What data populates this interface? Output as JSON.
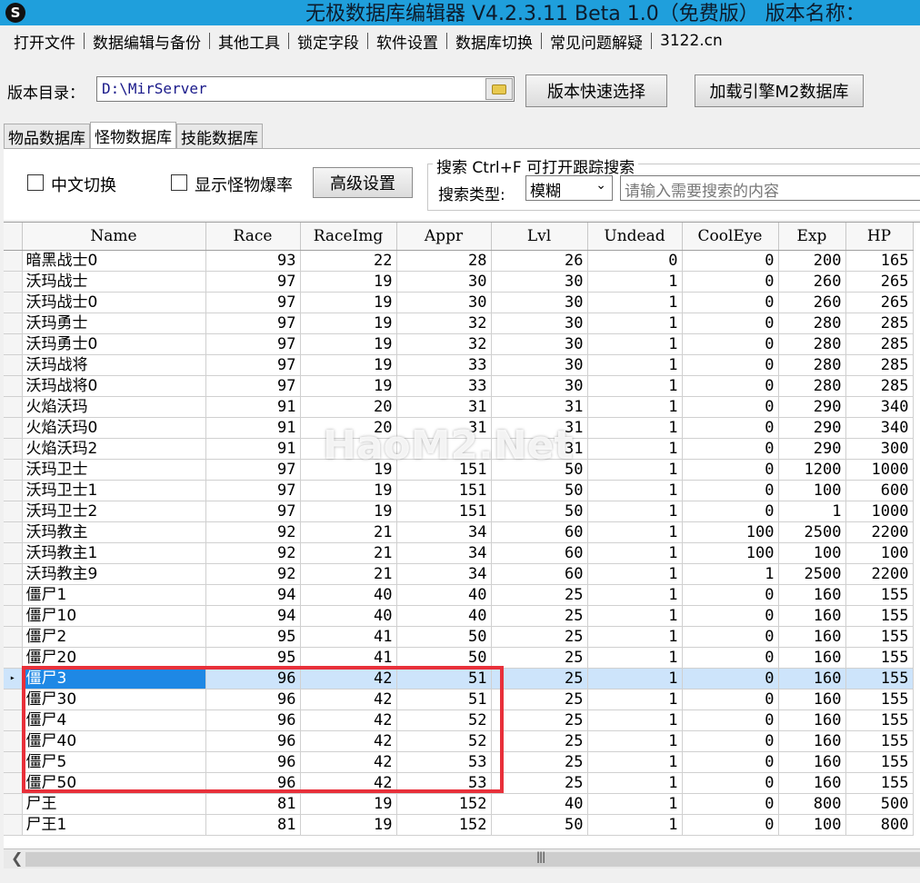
{
  "window": {
    "title": "无极数据库编辑器 V4.2.3.11    Beta 1.0（免费版）   版本名称："
  },
  "menu": [
    "打开文件",
    "数据编辑与备份",
    "其他工具",
    "锁定字段",
    "软件设置",
    "数据库切换",
    "常见问题解疑",
    "3122.cn"
  ],
  "directory": {
    "label": "版本目录：",
    "value": "D:\\MirServer",
    "quick_select_button": "版本快速选择",
    "load_m2_button": "加载引擎M2数据库"
  },
  "tabs": [
    "物品数据库",
    "怪物数据库",
    "技能数据库"
  ],
  "active_tab": 1,
  "options": {
    "chinese_switch": "中文切换",
    "show_drops": "显示怪物爆率",
    "advanced_button": "高级设置",
    "search_title": "搜索  Ctrl+F 可打开跟踪搜索",
    "search_type_label": "搜索类型:",
    "search_type_value": "模糊",
    "search_placeholder": "请输入需要搜索的内容"
  },
  "table": {
    "columns": [
      "Name",
      "Race",
      "RaceImg",
      "Appr",
      "Lvl",
      "Undead",
      "CoolEye",
      "Exp",
      "HP"
    ],
    "rows": [
      [
        "暗黑战士0",
        "93",
        "22",
        "28",
        "26",
        "0",
        "0",
        "200",
        "165"
      ],
      [
        "沃玛战士",
        "97",
        "19",
        "30",
        "30",
        "1",
        "0",
        "260",
        "265"
      ],
      [
        "沃玛战士0",
        "97",
        "19",
        "30",
        "30",
        "1",
        "0",
        "260",
        "265"
      ],
      [
        "沃玛勇士",
        "97",
        "19",
        "32",
        "30",
        "1",
        "0",
        "280",
        "285"
      ],
      [
        "沃玛勇士0",
        "97",
        "19",
        "32",
        "30",
        "1",
        "0",
        "280",
        "285"
      ],
      [
        "沃玛战将",
        "97",
        "19",
        "33",
        "30",
        "1",
        "0",
        "280",
        "285"
      ],
      [
        "沃玛战将0",
        "97",
        "19",
        "33",
        "30",
        "1",
        "0",
        "280",
        "285"
      ],
      [
        "火焰沃玛",
        "91",
        "20",
        "31",
        "31",
        "1",
        "0",
        "290",
        "340"
      ],
      [
        "火焰沃玛0",
        "91",
        "20",
        "31",
        "31",
        "1",
        "0",
        "290",
        "340"
      ],
      [
        "火焰沃玛2",
        "91",
        "",
        "",
        "31",
        "1",
        "0",
        "290",
        "300"
      ],
      [
        "沃玛卫士",
        "97",
        "19",
        "151",
        "50",
        "1",
        "0",
        "1200",
        "1000"
      ],
      [
        "沃玛卫士1",
        "97",
        "19",
        "151",
        "50",
        "1",
        "0",
        "100",
        "600"
      ],
      [
        "沃玛卫士2",
        "97",
        "19",
        "151",
        "50",
        "1",
        "0",
        "1",
        "1000"
      ],
      [
        "沃玛教主",
        "92",
        "21",
        "34",
        "60",
        "1",
        "100",
        "2500",
        "2200"
      ],
      [
        "沃玛教主1",
        "92",
        "21",
        "34",
        "60",
        "1",
        "100",
        "100",
        "100"
      ],
      [
        "沃玛教主9",
        "92",
        "21",
        "34",
        "60",
        "1",
        "1",
        "2500",
        "2200"
      ],
      [
        "僵尸1",
        "94",
        "40",
        "40",
        "25",
        "1",
        "0",
        "160",
        "155"
      ],
      [
        "僵尸10",
        "94",
        "40",
        "40",
        "25",
        "1",
        "0",
        "160",
        "155"
      ],
      [
        "僵尸2",
        "95",
        "41",
        "50",
        "25",
        "1",
        "0",
        "160",
        "155"
      ],
      [
        "僵尸20",
        "95",
        "41",
        "50",
        "25",
        "1",
        "0",
        "160",
        "155"
      ],
      [
        "僵尸3",
        "96",
        "42",
        "51",
        "25",
        "1",
        "0",
        "160",
        "155"
      ],
      [
        "僵尸30",
        "96",
        "42",
        "51",
        "25",
        "1",
        "0",
        "160",
        "155"
      ],
      [
        "僵尸4",
        "96",
        "42",
        "52",
        "25",
        "1",
        "0",
        "160",
        "155"
      ],
      [
        "僵尸40",
        "96",
        "42",
        "52",
        "25",
        "1",
        "0",
        "160",
        "155"
      ],
      [
        "僵尸5",
        "96",
        "42",
        "53",
        "25",
        "1",
        "0",
        "160",
        "155"
      ],
      [
        "僵尸50",
        "96",
        "42",
        "53",
        "25",
        "1",
        "0",
        "160",
        "155"
      ],
      [
        "尸王",
        "81",
        "19",
        "152",
        "40",
        "1",
        "0",
        "800",
        "500"
      ],
      [
        "尸王1",
        "81",
        "19",
        "152",
        "50",
        "1",
        "0",
        "100",
        "800"
      ]
    ],
    "selected_row": 20
  },
  "watermark": "HaoM2.Net",
  "colors": {
    "titlebar": "#1f9fdc",
    "selected_row": "#cde4fb",
    "selected_cell": "#1e88e5",
    "highlight_box": "#e8303a"
  }
}
